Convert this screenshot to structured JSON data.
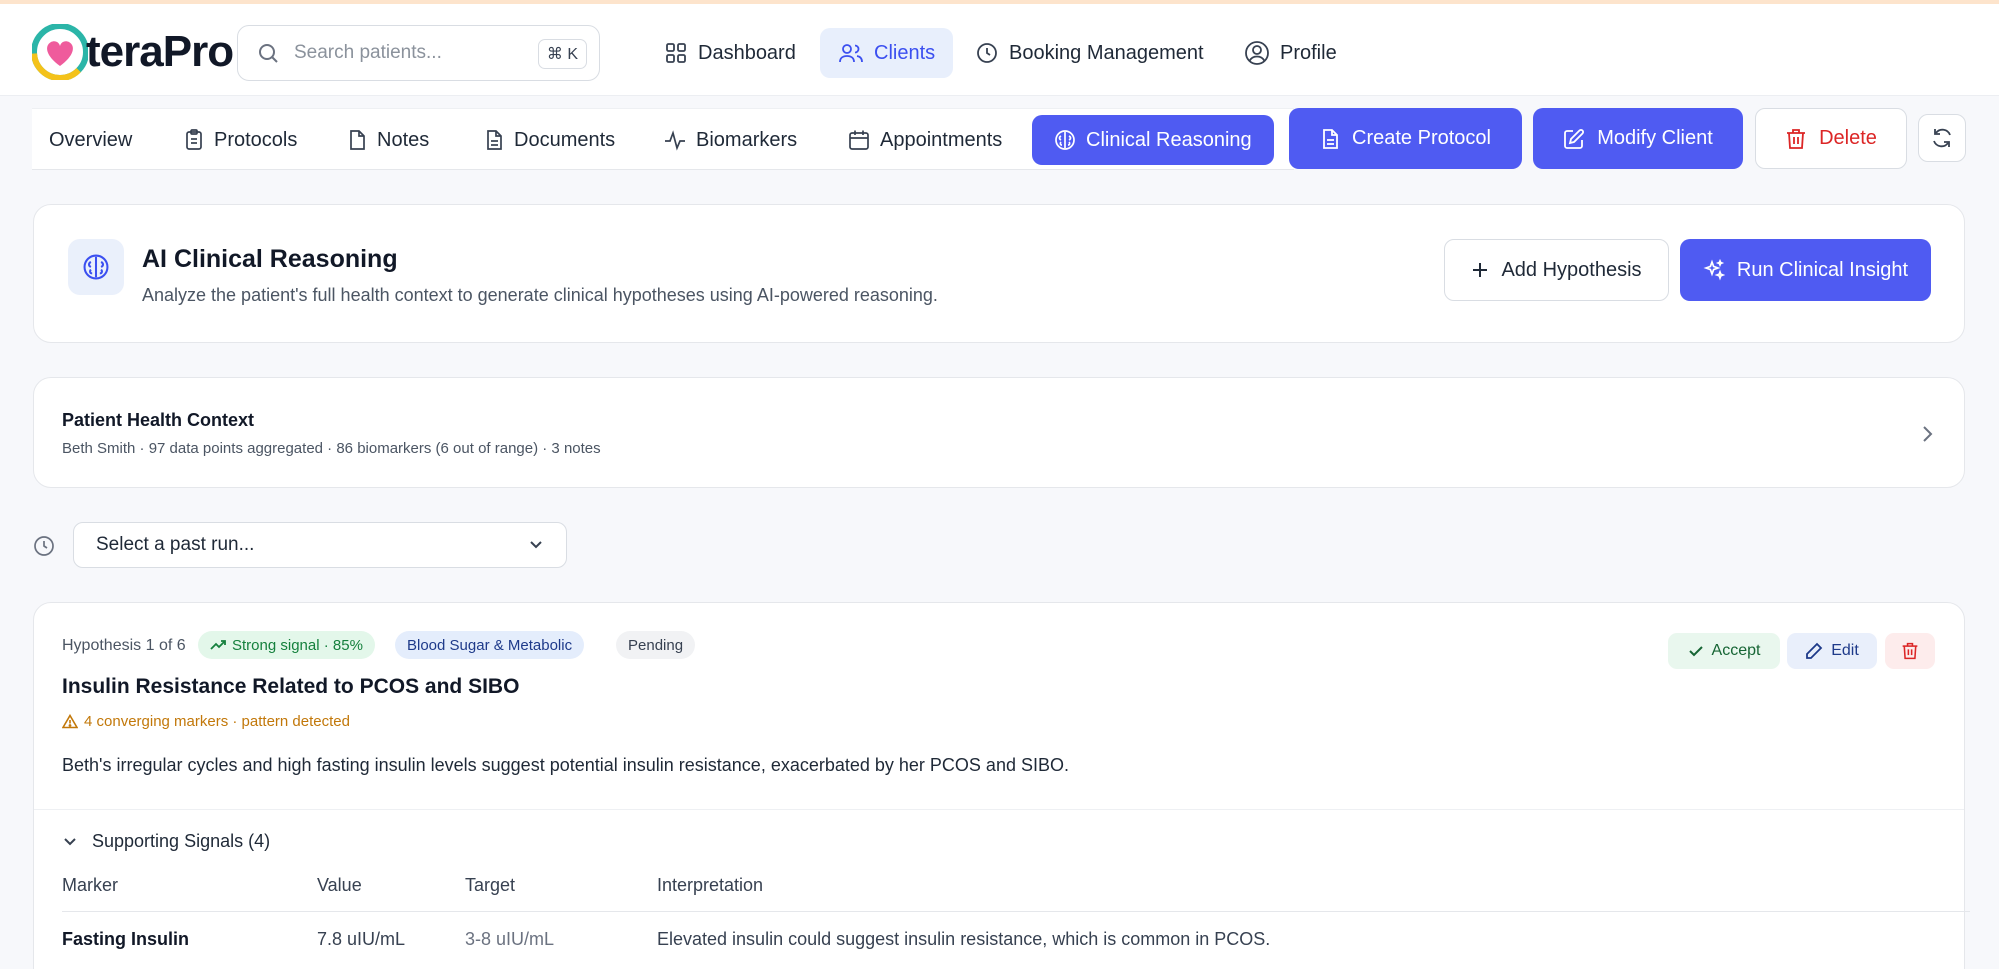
{
  "app": {
    "logo_text": "teraPro"
  },
  "search": {
    "placeholder": "Search patients...",
    "shortcut": "⌘ K"
  },
  "nav": [
    {
      "label": "Dashboard",
      "icon": "grid-icon",
      "active": false
    },
    {
      "label": "Clients",
      "icon": "users-icon",
      "active": true
    },
    {
      "label": "Booking Management",
      "icon": "clock-icon",
      "active": false
    },
    {
      "label": "Profile",
      "icon": "user-circle-icon",
      "active": false
    }
  ],
  "tabs": [
    {
      "label": "Overview",
      "icon": "",
      "active": false
    },
    {
      "label": "Protocols",
      "icon": "clipboard-icon",
      "active": false
    },
    {
      "label": "Notes",
      "icon": "file-icon",
      "active": false
    },
    {
      "label": "Documents",
      "icon": "document-icon",
      "active": false
    },
    {
      "label": "Biomarkers",
      "icon": "activity-icon",
      "active": false
    },
    {
      "label": "Appointments",
      "icon": "calendar-icon",
      "active": false
    },
    {
      "label": "Clinical Reasoning",
      "icon": "brain-icon",
      "active": true
    }
  ],
  "toolbar": {
    "create_protocol": "Create Protocol",
    "modify_client": "Modify Client",
    "delete": "Delete"
  },
  "reasoning": {
    "title": "AI Clinical Reasoning",
    "subtitle": "Analyze the patient's full health context to generate clinical hypotheses using AI-powered reasoning.",
    "add_hypothesis": "Add Hypothesis",
    "run_insight": "Run Clinical Insight"
  },
  "context": {
    "title": "Patient Health Context",
    "summary": "Beth Smith · 97 data points aggregated · 86 biomarkers (6 out of range) · 3 notes"
  },
  "past_run": {
    "placeholder": "Select a past run..."
  },
  "hypothesis": {
    "counter": "Hypothesis 1 of 6",
    "signal_badge": "Strong signal · 85%",
    "category_badge": "Blood Sugar & Metabolic",
    "status_badge": "Pending",
    "title": "Insulin Resistance Related to PCOS and SIBO",
    "warning": "4 converging markers · pattern detected",
    "description": "Beth's irregular cycles and high fasting insulin levels suggest potential insulin resistance, exacerbated by her PCOS and SIBO.",
    "accept": "Accept",
    "edit": "Edit",
    "supporting_label": "Supporting Signals (4)",
    "columns": [
      "Marker",
      "Value",
      "Target",
      "Interpretation"
    ],
    "rows": [
      {
        "marker": "Fasting Insulin",
        "value": "7.8 uIU/mL",
        "target": "3-8 uIU/mL",
        "interpretation": "Elevated insulin could suggest insulin resistance, which is common in PCOS."
      }
    ]
  },
  "colors": {
    "accent": "#4f5bf2",
    "danger": "#dc2626",
    "success": "#15803d",
    "warning": "#c2780a"
  }
}
